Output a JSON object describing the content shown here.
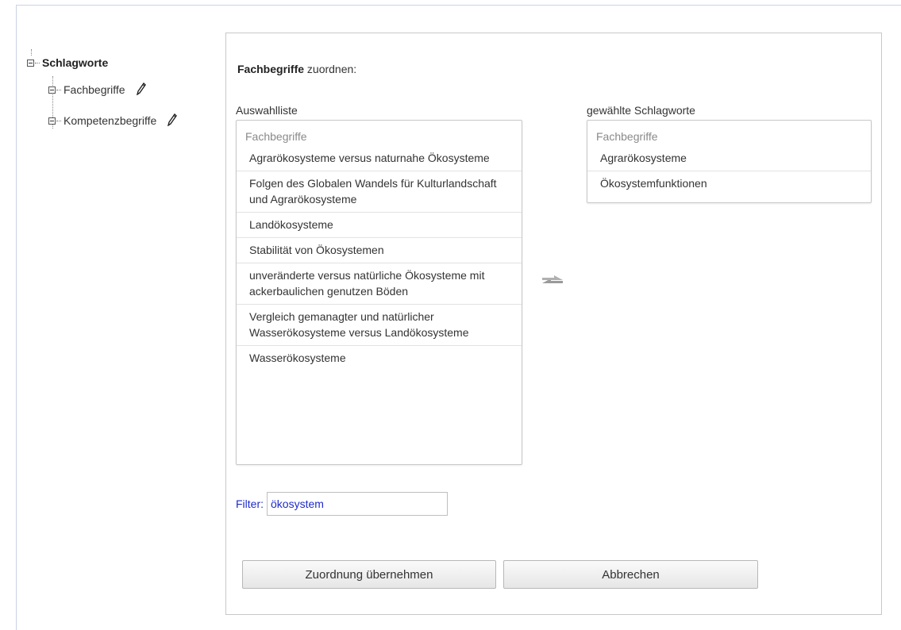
{
  "tree": {
    "root": "Schlagworte",
    "children": [
      {
        "label": "Fachbegriffe",
        "edit_icon": "pencil-icon"
      },
      {
        "label": "Kompetenzbegriffe",
        "edit_icon": "pencil-icon"
      }
    ]
  },
  "panel": {
    "heading_bold": "Fachbegriffe",
    "heading_rest": " zuordnen:",
    "left_title": "Auswahlliste",
    "right_title": "gewählte Schlagworte",
    "left_list": {
      "group": "Fachbegriffe",
      "items": [
        "Agrarökosysteme versus naturnahe Ökosysteme",
        "Folgen des Globalen Wandels für Kulturlandschaft und Agrarökosysteme",
        "Landökosysteme",
        "Stabilität von Ökosystemen",
        "unveränderte versus natürliche Ökosysteme mit ackerbaulichen genutzen Böden",
        "Vergleich gemanagter und natürlicher Wasserökosysteme versus Landökosysteme",
        "Wasserökosysteme"
      ]
    },
    "right_list": {
      "group": "Fachbegriffe",
      "items": [
        "Agrarökosysteme",
        "Ökosystemfunktionen"
      ]
    },
    "swap_icon": "swap-arrows-icon",
    "filter": {
      "label": "Filter:",
      "value": "ökosystem"
    },
    "buttons": {
      "apply": "Zuordnung übernehmen",
      "cancel": "Abbrechen"
    }
  },
  "colors": {
    "filter_text": "#1e2bc8",
    "border": "#c8c8c8",
    "group_text": "#8a8a8a"
  }
}
